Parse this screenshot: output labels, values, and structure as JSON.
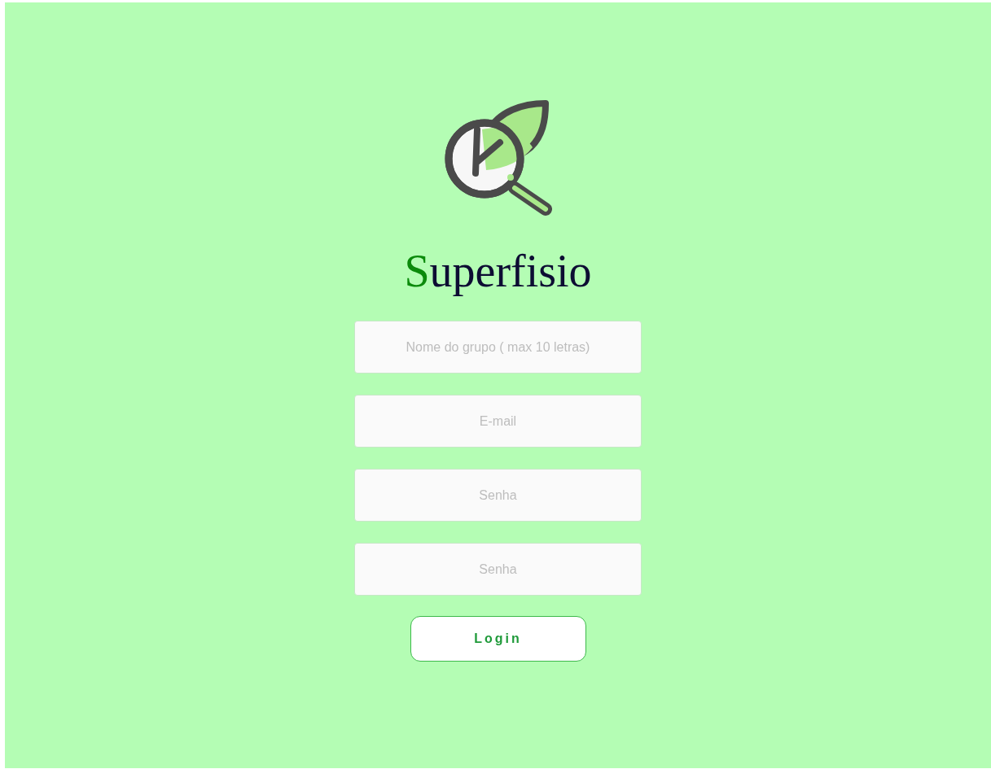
{
  "title": {
    "text": "Superfisio"
  },
  "fields": [
    {
      "placeholder": "Nome do grupo ( max 10 letras)"
    },
    {
      "placeholder": "E-mail"
    },
    {
      "placeholder": "Senha"
    },
    {
      "placeholder": "Senha"
    }
  ],
  "button": {
    "label": "Login"
  }
}
